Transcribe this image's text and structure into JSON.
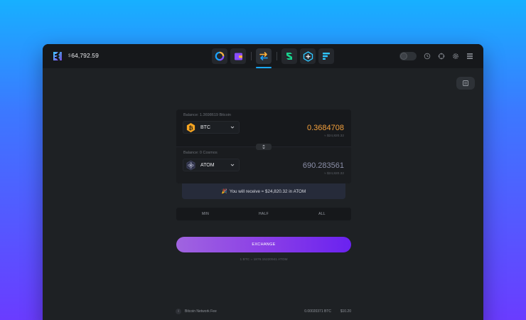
{
  "header": {
    "balance_currency": "$",
    "balance_value": "64,792.59",
    "apps": [
      {
        "name": "portfolio-icon",
        "active": false
      },
      {
        "name": "wallet-icon",
        "active": false
      },
      {
        "name": "exchange-icon",
        "active": true
      },
      {
        "name": "app-s-icon",
        "active": false
      },
      {
        "name": "app-cube-icon",
        "active": false
      },
      {
        "name": "app-stripes-icon",
        "active": false
      }
    ],
    "tools": [
      "toggle-switch",
      "history-icon",
      "crosshair-icon",
      "settings-icon",
      "grid-menu-icon"
    ]
  },
  "exchange": {
    "from": {
      "balance_label": "Balance: 1.3698619 Bitcoin",
      "asset": "BTC",
      "amount": "0.3684708",
      "usd_value": "≈ $24,820.32",
      "icon": "bitcoin-icon",
      "color": "#f5a13c"
    },
    "to": {
      "balance_label": "Balance: 0 Cosmos",
      "asset": "ATOM",
      "amount": "690.283561",
      "usd_value": "≈ $24,820.32",
      "icon": "cosmos-icon"
    },
    "receive_emoji": "🎉",
    "receive_text": "You will receive ≈ $24,820.32 in ATOM",
    "portions": [
      "MIN",
      "HALF",
      "ALL"
    ],
    "exchange_label": "EXCHANGE",
    "rate": "1 BTC = 1876.15220941 ATOM"
  },
  "fee": {
    "label": "Bitcoin Network Fee",
    "btc": "0.00020371 BTC",
    "usd": "$10.20"
  },
  "colors": {
    "accent": "#19a8ff",
    "exchange_gradient_start": "#a064e0",
    "exchange_gradient_end": "#6a22f0"
  }
}
